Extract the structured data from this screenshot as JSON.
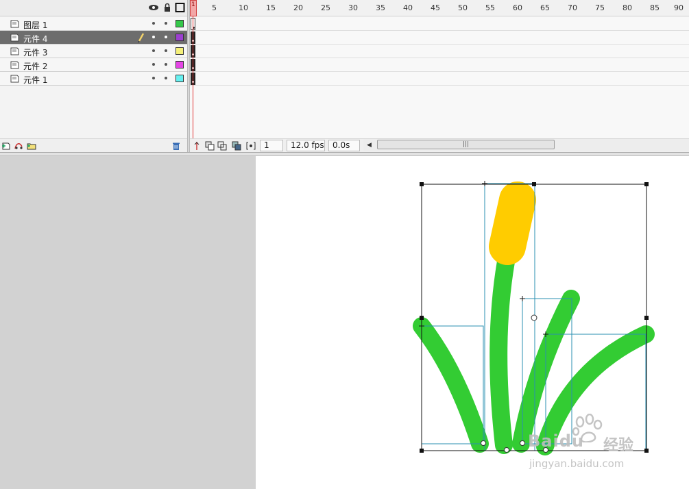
{
  "timeline": {
    "header_icons": [
      "eye-icon",
      "lock-icon",
      "outline-icon"
    ],
    "layers": [
      {
        "name": "图层 1",
        "color": "#35c84a",
        "selected": false
      },
      {
        "name": "元件 4",
        "color": "#9c3fd0",
        "selected": true
      },
      {
        "name": "元件 3",
        "color": "#f5f07a",
        "selected": false
      },
      {
        "name": "元件 2",
        "color": "#e545e5",
        "selected": false
      },
      {
        "name": "元件 1",
        "color": "#66f0f0",
        "selected": false
      }
    ],
    "ruler_labels": [
      "1",
      "5",
      "10",
      "15",
      "20",
      "25",
      "30",
      "35",
      "40",
      "45",
      "50",
      "55",
      "60",
      "65",
      "70",
      "75",
      "80",
      "85",
      "90"
    ],
    "current_frame": "1",
    "frame_rate": "12.0 fps",
    "elapsed_time": "0.0s"
  },
  "stage": {
    "stem_color": "#33cc33",
    "flower_color": "#ffcc00",
    "bbox_color": "#2a8fb0"
  },
  "watermark": {
    "brand": "Baidu",
    "suffix": "经验",
    "url": "jingyan.baidu.com"
  }
}
